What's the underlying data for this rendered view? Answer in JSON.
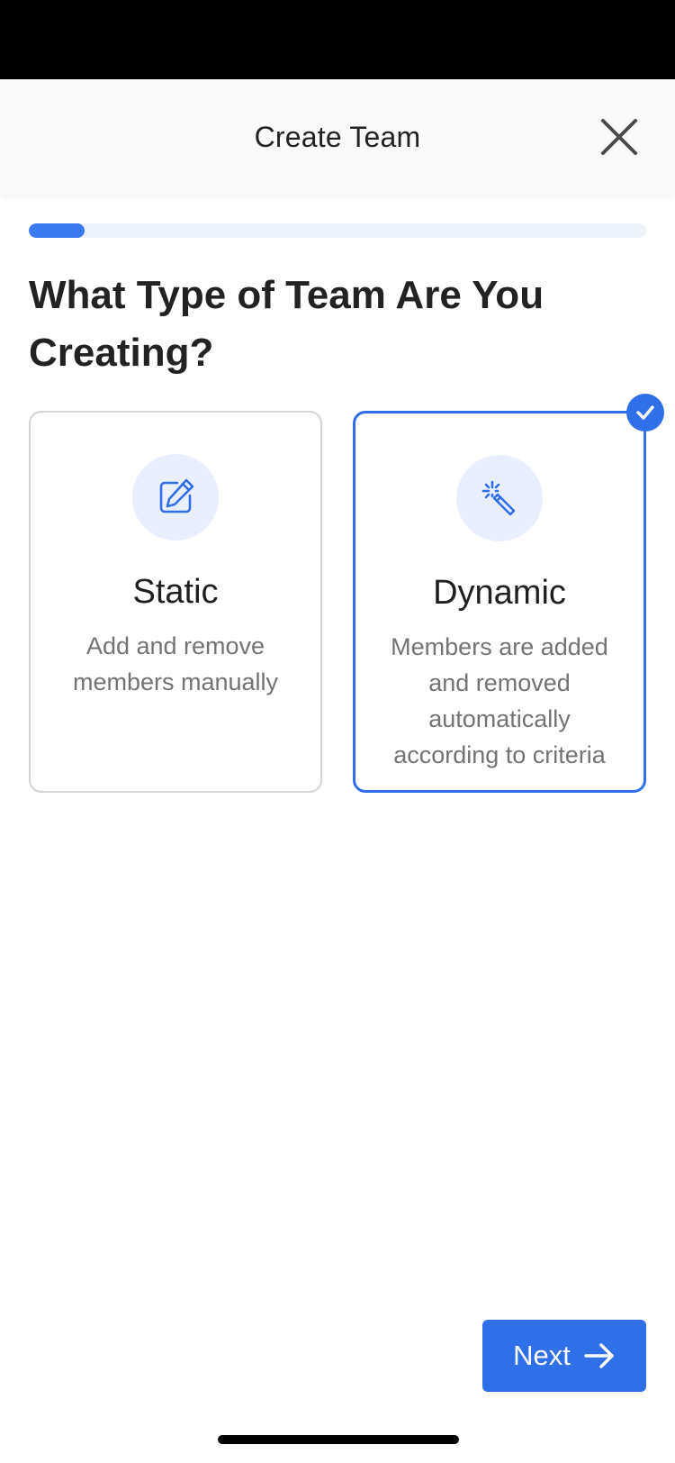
{
  "header": {
    "title": "Create Team",
    "close_icon": "close-icon"
  },
  "progress": {
    "value_fraction": 0.09,
    "fill_color": "#3b7af0",
    "track_color": "#eef2fb"
  },
  "question": "What Type of Team Are You Creating?",
  "options": [
    {
      "title": "Static",
      "description": "Add and remove members manually",
      "icon": "edit-pencil-icon",
      "selected": false
    },
    {
      "title": "Dynamic",
      "description": "Members are added and removed automatically according to criteria",
      "icon": "magic-wand-icon",
      "selected": true
    }
  ],
  "footer": {
    "next_label": "Next",
    "next_icon": "arrow-right-icon"
  },
  "colors": {
    "accent": "#2f6fe8",
    "icon_bg": "#e9efff"
  }
}
